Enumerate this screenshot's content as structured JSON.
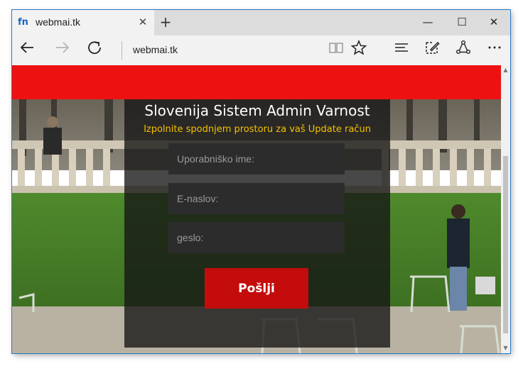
{
  "browser": {
    "tab": {
      "favicon": "fn",
      "title": "webmai.tk",
      "close_icon": "close-icon"
    },
    "new_tab_icon": "plus-icon",
    "window_controls": {
      "minimize": "minimize-icon",
      "maximize": "maximize-icon",
      "close": "close-icon"
    },
    "nav": {
      "back": "back-arrow-icon",
      "forward": "forward-arrow-icon",
      "refresh": "refresh-icon"
    },
    "address": "webmai.tk",
    "toolbar_icons": [
      "reading-view-icon",
      "favorite-star-icon",
      "hub-icon",
      "web-note-icon",
      "share-icon",
      "more-icon"
    ]
  },
  "page": {
    "heading": "Slovenija Sistem Admin Varnost",
    "subheading": "Izpolnite spodnjem prostoru za vaš Update račun",
    "fields": {
      "username_placeholder": "Uporabniško ime:",
      "email_placeholder": "E-naslov:",
      "password_placeholder": "geslo:"
    },
    "submit_label": "Pošlji",
    "colors": {
      "banner": "#ee1111",
      "button": "#c40c0c",
      "subheading": "#f5c000"
    }
  }
}
